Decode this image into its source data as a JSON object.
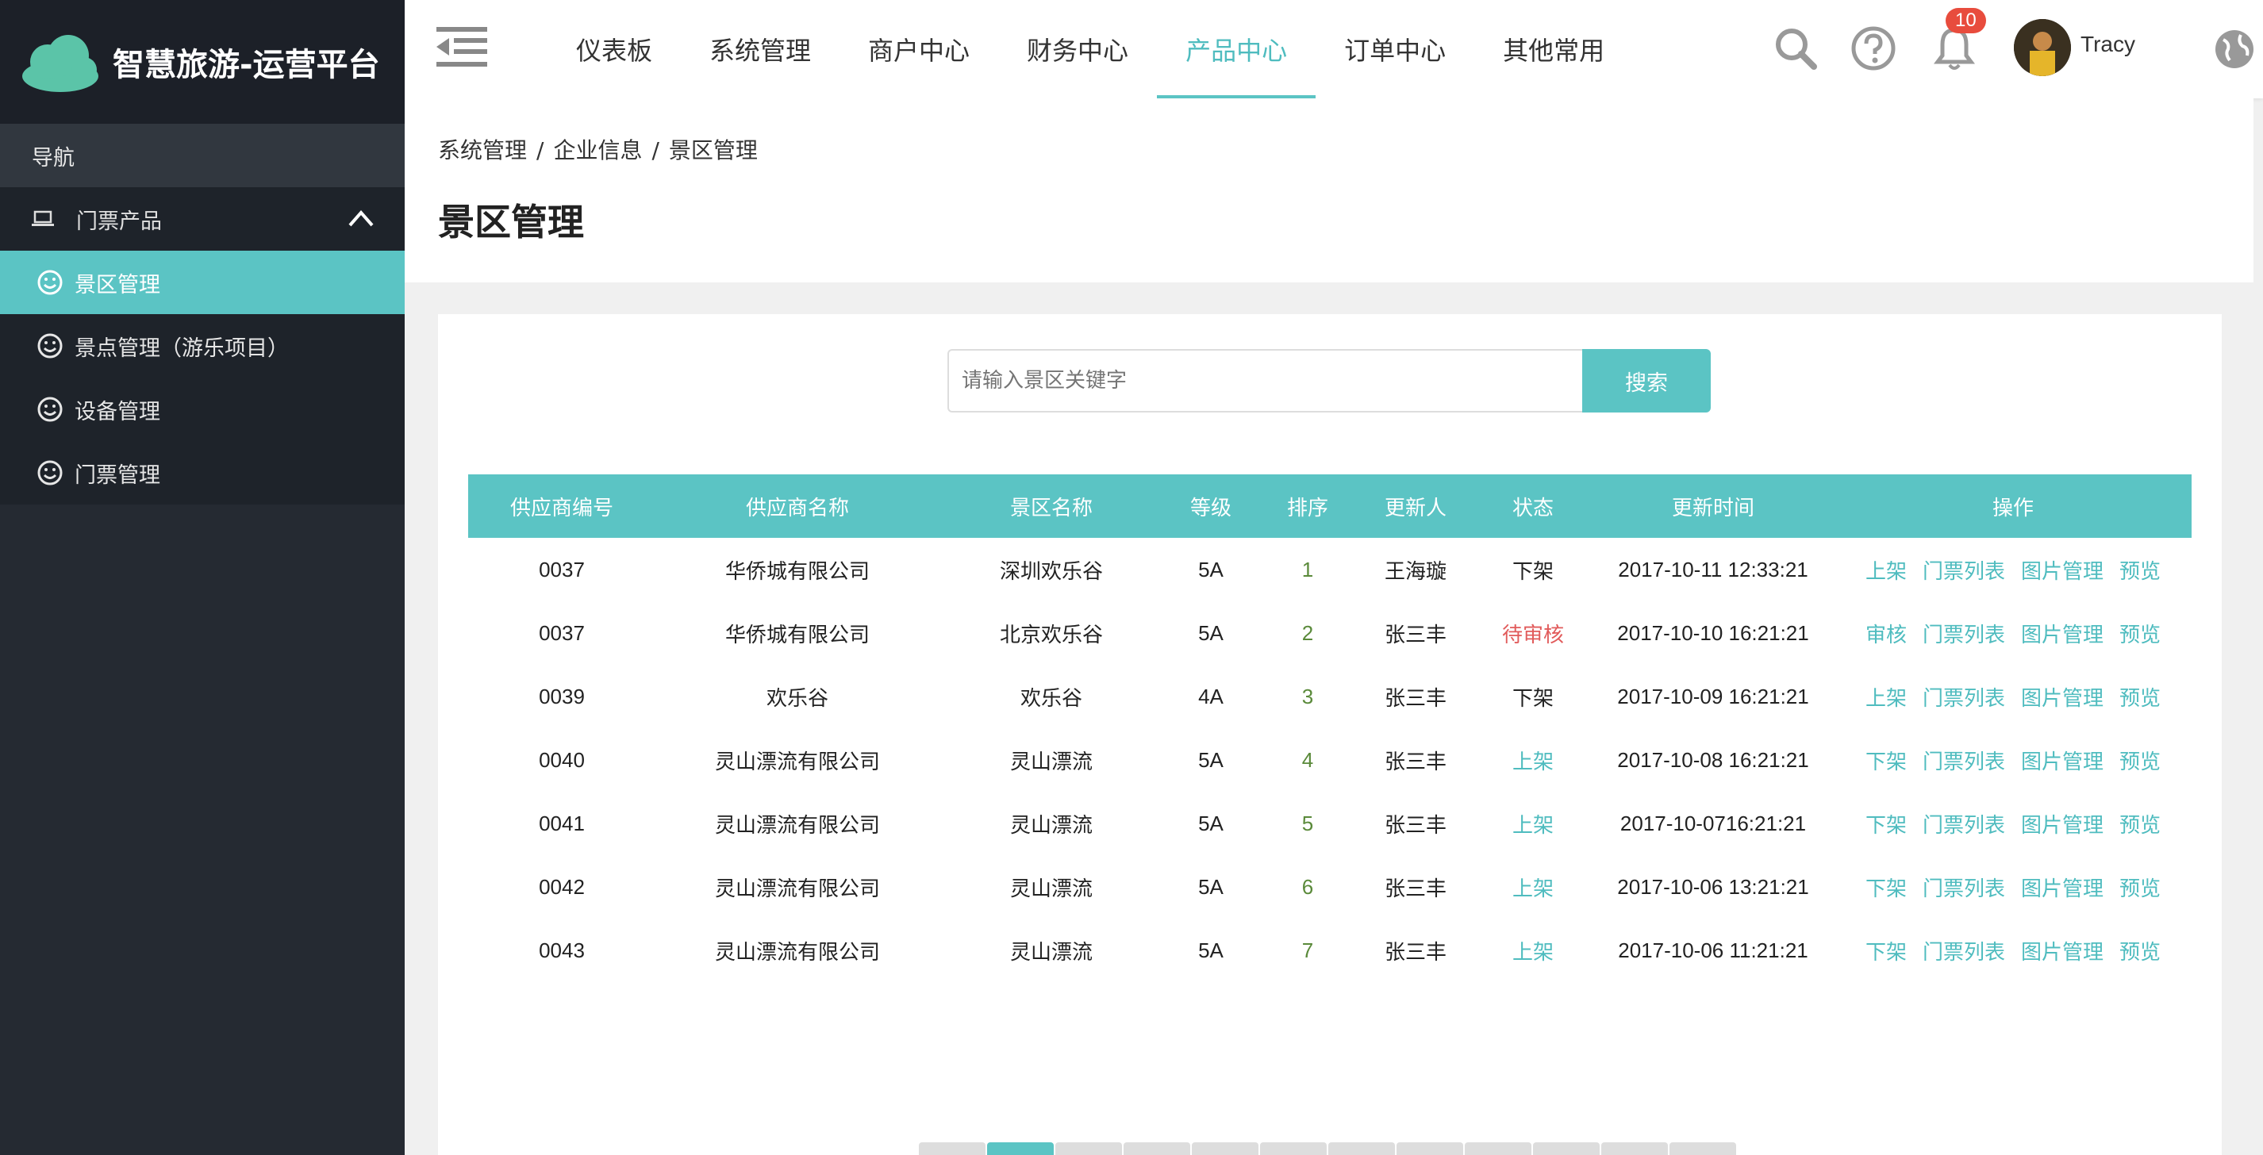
{
  "brand": {
    "title": "智慧旅游-运营平台"
  },
  "sidebar": {
    "header": "导航",
    "group": "门票产品",
    "items": [
      {
        "label": "景区管理",
        "active": true
      },
      {
        "label": "景点管理（游乐项目）",
        "active": false
      },
      {
        "label": "设备管理",
        "active": false
      },
      {
        "label": "门票管理",
        "active": false
      }
    ]
  },
  "topnav": {
    "tabs": [
      "仪表板",
      "系统管理",
      "商户中心",
      "财务中心",
      "产品中心",
      "订单中心",
      "其他常用"
    ],
    "active_index": 4,
    "notification_count": "10",
    "username": "Tracy"
  },
  "breadcrumb": [
    "系统管理",
    "企业信息",
    "景区管理"
  ],
  "page_title": "景区管理",
  "search": {
    "placeholder": "请输入景区关键字",
    "button": "搜索"
  },
  "table": {
    "headers": [
      "供应商编号",
      "供应商名称",
      "景区名称",
      "等级",
      "排序",
      "更新人",
      "状态",
      "更新时间",
      "操作"
    ],
    "rows": [
      {
        "id": "0037",
        "supplier": "华侨城有限公司",
        "scenic": "深圳欢乐谷",
        "level": "5A",
        "rank": "1",
        "updater": "王海璇",
        "status": "下架",
        "status_type": "off",
        "time": "2017-10-11 12:33:21",
        "ops": [
          "上架",
          "门票列表",
          "图片管理",
          "预览"
        ]
      },
      {
        "id": "0037",
        "supplier": "华侨城有限公司",
        "scenic": "北京欢乐谷",
        "level": "5A",
        "rank": "2",
        "updater": "张三丰",
        "status": "待审核",
        "status_type": "pending",
        "time": "2017-10-10 16:21:21",
        "ops": [
          "审核",
          "门票列表",
          "图片管理",
          "预览"
        ]
      },
      {
        "id": "0039",
        "supplier": "欢乐谷",
        "scenic": "欢乐谷",
        "level": "4A",
        "rank": "3",
        "updater": "张三丰",
        "status": "下架",
        "status_type": "off",
        "time": "2017-10-09 16:21:21",
        "ops": [
          "上架",
          "门票列表",
          "图片管理",
          "预览"
        ]
      },
      {
        "id": "0040",
        "supplier": "灵山漂流有限公司",
        "scenic": "灵山漂流",
        "level": "5A",
        "rank": "4",
        "updater": "张三丰",
        "status": "上架",
        "status_type": "on",
        "time": "2017-10-08 16:21:21",
        "ops": [
          "下架",
          "门票列表",
          "图片管理",
          "预览"
        ]
      },
      {
        "id": "0041",
        "supplier": "灵山漂流有限公司",
        "scenic": "灵山漂流",
        "level": "5A",
        "rank": "5",
        "updater": "张三丰",
        "status": "上架",
        "status_type": "on",
        "time": "2017-10-0716:21:21",
        "ops": [
          "下架",
          "门票列表",
          "图片管理",
          "预览"
        ]
      },
      {
        "id": "0042",
        "supplier": "灵山漂流有限公司",
        "scenic": "灵山漂流",
        "level": "5A",
        "rank": "6",
        "updater": "张三丰",
        "status": "上架",
        "status_type": "on",
        "time": "2017-10-06 13:21:21",
        "ops": [
          "下架",
          "门票列表",
          "图片管理",
          "预览"
        ]
      },
      {
        "id": "0043",
        "supplier": "灵山漂流有限公司",
        "scenic": "灵山漂流",
        "level": "5A",
        "rank": "7",
        "updater": "张三丰",
        "status": "上架",
        "status_type": "on",
        "time": "2017-10-06 11:21:21",
        "ops": [
          "下架",
          "门票列表",
          "图片管理",
          "预览"
        ]
      }
    ]
  },
  "colors": {
    "accent": "#5bc4c4",
    "sidebar": "#252a32",
    "pending": "#e15b5b",
    "badge": "#e84c3d"
  },
  "icons": [
    "cloud-logo-icon",
    "laptop-icon",
    "chevron-up-icon",
    "smile-icon",
    "menu-toggle-icon",
    "search-icon",
    "help-icon",
    "bell-icon",
    "globe-icon"
  ]
}
